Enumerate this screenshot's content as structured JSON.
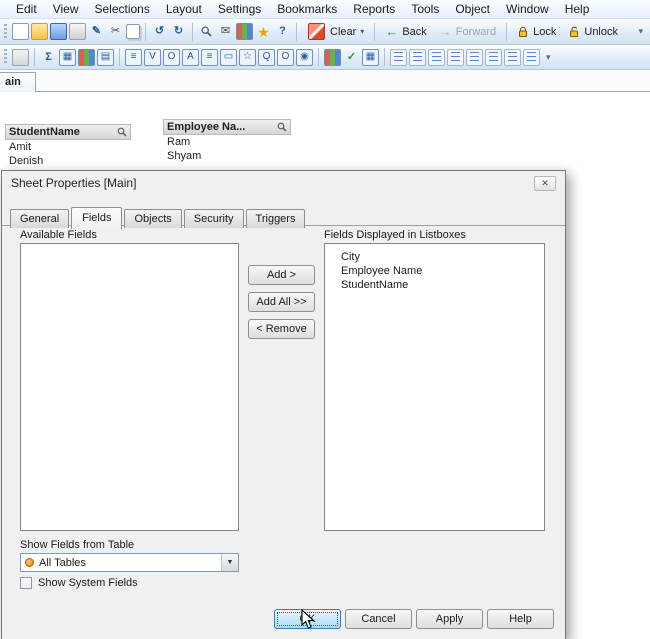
{
  "menubar": {
    "items": [
      "Edit",
      "View",
      "Selections",
      "Layout",
      "Settings",
      "Bookmarks",
      "Reports",
      "Tools",
      "Object",
      "Window",
      "Help"
    ]
  },
  "toolbars": {
    "main_icons": [
      {
        "name": "new-document",
        "glyph": ""
      },
      {
        "name": "open-file",
        "glyph": ""
      },
      {
        "name": "save",
        "glyph": ""
      },
      {
        "name": "print",
        "glyph": ""
      },
      {
        "name": "edit-script",
        "glyph": "✎"
      },
      {
        "name": "cut",
        "glyph": "✂"
      },
      {
        "name": "copy",
        "glyph": ""
      },
      {
        "name": "undo",
        "glyph": "↺"
      },
      {
        "name": "redo",
        "glyph": "↻"
      },
      {
        "name": "search",
        "glyph": ""
      },
      {
        "name": "send-mail",
        "glyph": "✉"
      },
      {
        "name": "chart-wizard",
        "glyph": ""
      },
      {
        "name": "favorites",
        "glyph": "★"
      },
      {
        "name": "help",
        "glyph": "?"
      }
    ],
    "clear_label": "Clear",
    "back_label": "Back",
    "forward_label": "Forward",
    "lock_label": "Lock",
    "unlock_label": "Unlock",
    "back_glyph": "←",
    "forward_glyph": "→",
    "dropdown_glyph": "▾",
    "overflow_glyph": "▾",
    "design_icons": [
      {
        "name": "sheet-properties",
        "glyph": ""
      },
      {
        "name": "sum",
        "glyph": "Σ"
      },
      {
        "name": "table-box",
        "glyph": "▦"
      },
      {
        "name": "chart-wizard",
        "glyph": ""
      },
      {
        "name": "pivot-table",
        "glyph": "▤"
      },
      {
        "name": "listbox-object",
        "glyph": "≡"
      },
      {
        "name": "statistics-box",
        "glyph": "V"
      },
      {
        "name": "multibox",
        "glyph": "O"
      },
      {
        "name": "text-object",
        "glyph": "A"
      },
      {
        "name": "current-selections-box",
        "glyph": "≡"
      },
      {
        "name": "slider-object",
        "glyph": "▭"
      },
      {
        "name": "bookmark-object",
        "glyph": "☆"
      },
      {
        "name": "search-object",
        "glyph": "Q"
      },
      {
        "name": "container-object",
        "glyph": "O"
      },
      {
        "name": "button-object",
        "glyph": "◉"
      },
      {
        "name": "chart-colored",
        "glyph": ""
      },
      {
        "name": "apply-theme",
        "glyph": "✓"
      },
      {
        "name": "grid-chart",
        "glyph": "▦"
      },
      {
        "name": "align-left",
        "glyph": ""
      },
      {
        "name": "align-right",
        "glyph": ""
      },
      {
        "name": "align-top",
        "glyph": ""
      },
      {
        "name": "align-bottom",
        "glyph": ""
      },
      {
        "name": "center-horizontal",
        "glyph": ""
      },
      {
        "name": "center-vertical",
        "glyph": ""
      },
      {
        "name": "space-horizontal",
        "glyph": ""
      },
      {
        "name": "space-vertical",
        "glyph": ""
      }
    ]
  },
  "sheet_tab": {
    "label": "ain"
  },
  "listboxes": [
    {
      "title": "StudentName",
      "items": [
        "Amit",
        "Denish"
      ]
    },
    {
      "title": "Employee Na...",
      "items": [
        "Ram",
        "Shyam"
      ]
    }
  ],
  "dialog": {
    "title": "Sheet Properties [Main]",
    "close_glyph": "✕",
    "tabs": [
      "General",
      "Fields",
      "Objects",
      "Security",
      "Triggers"
    ],
    "active_tab": "Fields",
    "available_fields_label": "Available Fields",
    "fields_displayed_label": "Fields Displayed in Listboxes",
    "displayed_fields": [
      "City",
      "Employee Name",
      "StudentName"
    ],
    "add_label": "Add >",
    "add_all_label": "Add All >>",
    "remove_label": "< Remove",
    "show_fields_from_table_label": "Show Fields from Table",
    "table_dropdown_value": "All Tables",
    "combo_arrow_glyph": "▼",
    "show_system_fields_label": "Show System Fields",
    "ok_label": "OK",
    "cancel_label": "Cancel",
    "apply_label": "Apply",
    "help_label": "Help"
  },
  "colors": {
    "toolbar_bg": "#d2e2f3",
    "dialog_bg": "#f0f0f0",
    "default_button_border": "#3c7fb1",
    "table_dot_orange": "#ee7d00"
  }
}
